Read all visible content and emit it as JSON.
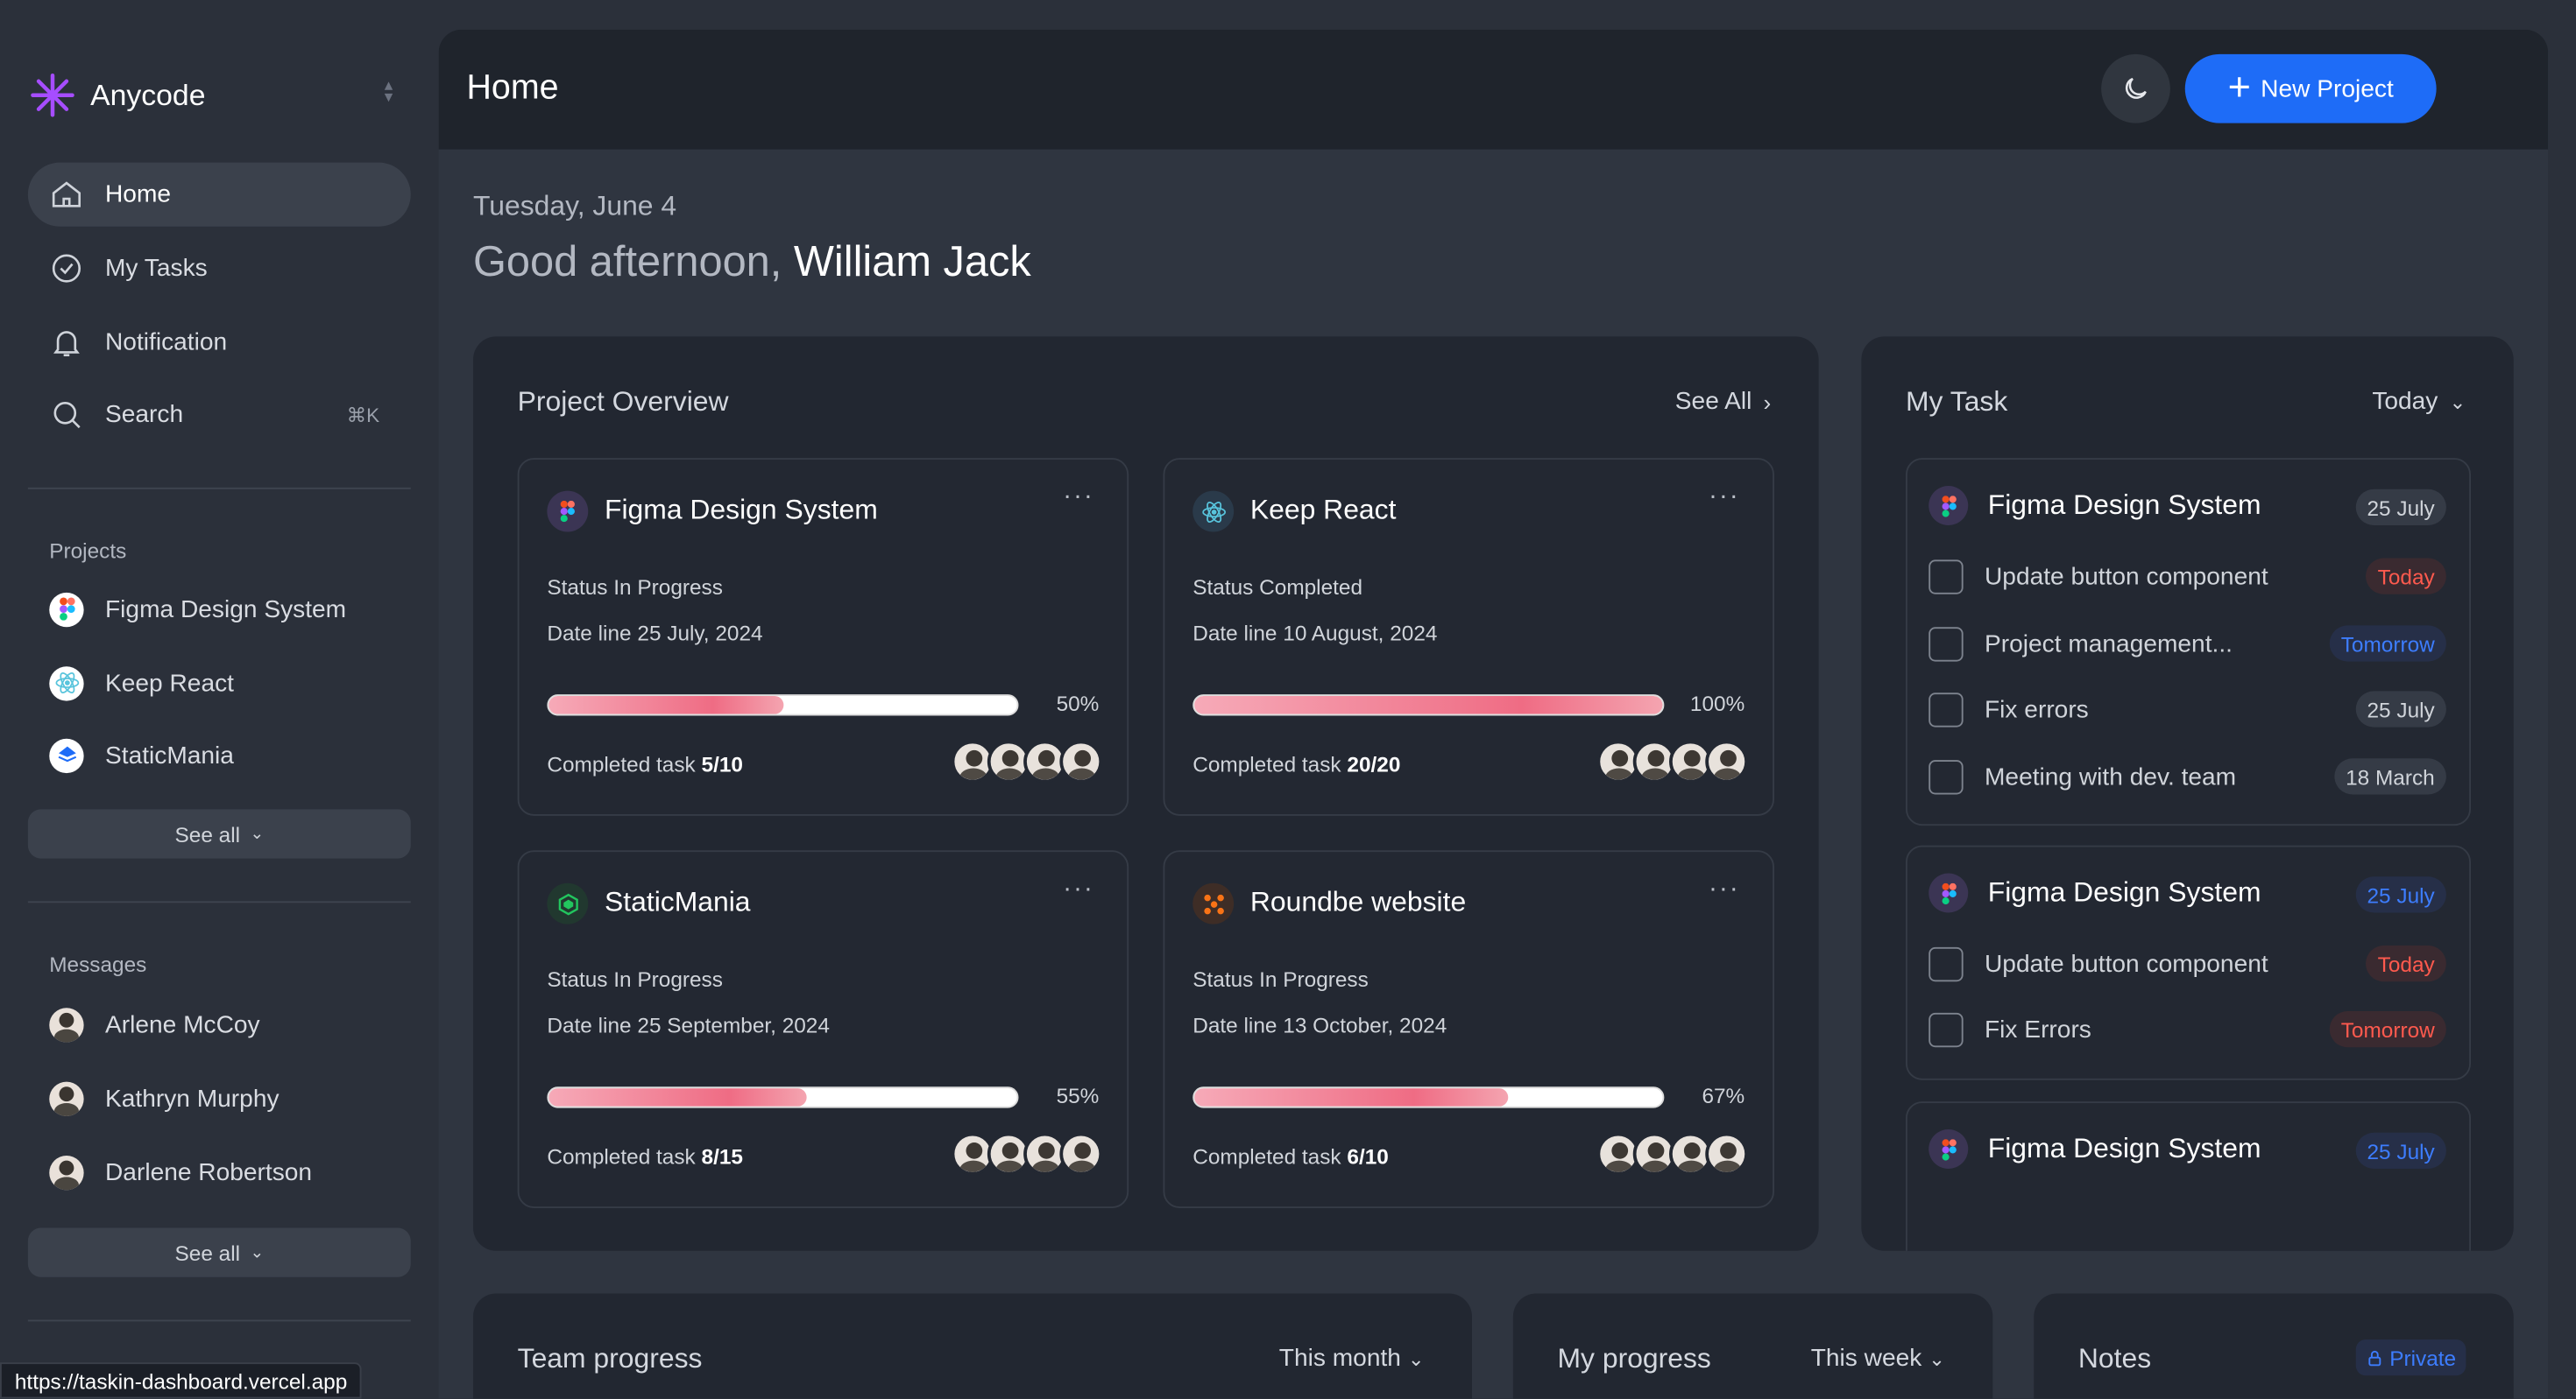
{
  "app": {
    "name": "Anycode",
    "url": "https://taskin-dashboard.vercel.app"
  },
  "nav": [
    {
      "label": "Home",
      "icon": "home-icon",
      "active": true
    },
    {
      "label": "My Tasks",
      "icon": "check-circle-icon"
    },
    {
      "label": "Notification",
      "icon": "bell-icon"
    },
    {
      "label": "Search",
      "icon": "search-icon",
      "shortcut": "⌘K"
    }
  ],
  "projects_section": {
    "label": "Projects",
    "items": [
      {
        "name": "Figma Design System",
        "icon": "figma-icon"
      },
      {
        "name": "Keep React",
        "icon": "react-icon"
      },
      {
        "name": "StaticMania",
        "icon": "staticmania-icon"
      }
    ],
    "see_all": "See all"
  },
  "messages_section": {
    "label": "Messages",
    "items": [
      {
        "name": "Arlene McCoy"
      },
      {
        "name": "Kathryn Murphy"
      },
      {
        "name": "Darlene Robertson"
      }
    ],
    "see_all": "See all"
  },
  "header": {
    "title": "Home",
    "new_project": "New Project"
  },
  "greeting": {
    "date": "Tuesday, June 4",
    "salutation": "Good afternoon,",
    "name": "William Jack"
  },
  "project_overview": {
    "title": "Project Overview",
    "see_all": "See All",
    "cards": [
      {
        "name": "Figma Design System",
        "status_label": "Status",
        "status": "In Progress",
        "date_label": "Date line",
        "date": "25 July, 2024",
        "progress": 50,
        "progress_text": "50%",
        "completed_label": "Completed task",
        "completed": "5/10"
      },
      {
        "name": "Keep React",
        "status_label": "Status",
        "status": "Completed",
        "date_label": "Date line",
        "date": "10 August, 2024",
        "progress": 100,
        "progress_text": "100%",
        "completed_label": "Completed task",
        "completed": "20/20"
      },
      {
        "name": "StaticMania",
        "status_label": "Status",
        "status": "In Progress",
        "date_label": "Date line",
        "date": "25 September, 2024",
        "progress": 55,
        "progress_text": "55%",
        "completed_label": "Completed task",
        "completed": "8/15"
      },
      {
        "name": "Roundbe website",
        "status_label": "Status",
        "status": "In Progress",
        "date_label": "Date line",
        "date": "13 October, 2024",
        "progress": 67,
        "progress_text": "67%",
        "completed_label": "Completed task",
        "completed": "6/10"
      }
    ]
  },
  "my_task": {
    "title": "My Task",
    "filter": "Today",
    "groups": [
      {
        "project": "Figma Design System",
        "date": "25 July",
        "date_style": "gray",
        "tasks": [
          {
            "label": "Update button component",
            "due": "Today",
            "style": "red"
          },
          {
            "label": "Project management...",
            "due": "Tomorrow",
            "style": "blue"
          },
          {
            "label": "Fix errors",
            "due": "25 July",
            "style": "gray"
          },
          {
            "label": "Meeting with dev. team",
            "due": "18 March",
            "style": "gray"
          }
        ]
      },
      {
        "project": "Figma Design System",
        "date": "25 July",
        "date_style": "blue",
        "tasks": [
          {
            "label": "Update button component",
            "due": "Today",
            "style": "red"
          },
          {
            "label": "Fix Errors",
            "due": "Tomorrow",
            "style": "red"
          }
        ]
      },
      {
        "project": "Figma Design System",
        "date": "25 July",
        "date_style": "blue",
        "tasks": []
      }
    ]
  },
  "team_progress": {
    "title": "Team progress",
    "filter": "This month"
  },
  "my_progress": {
    "title": "My progress",
    "filter": "This week"
  },
  "notes": {
    "title": "Notes",
    "badge": "Private"
  },
  "colors": {
    "accent": "#1e6cf7",
    "progress": "#ef6c84",
    "danger": "#ff5a4e",
    "info": "#3d7dff"
  }
}
